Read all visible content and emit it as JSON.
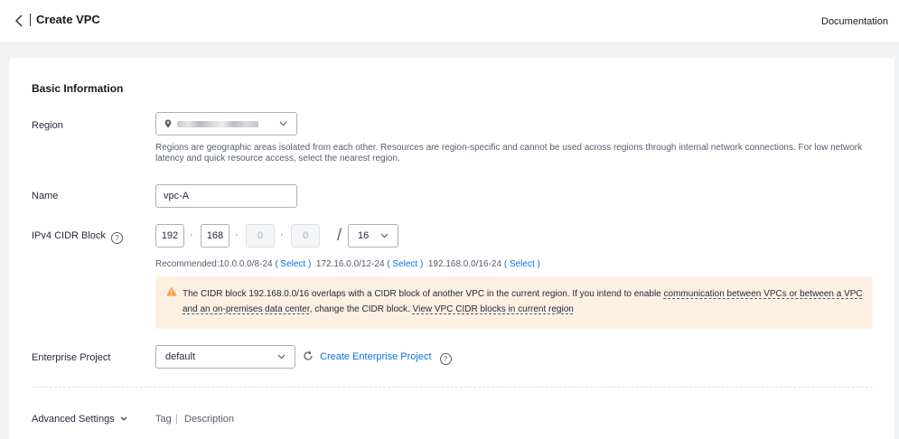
{
  "header": {
    "title": "Create VPC",
    "documentation": "Documentation"
  },
  "basic": {
    "section_title": "Basic Information",
    "region": {
      "label": "Region",
      "hint": "Regions are geographic areas isolated from each other. Resources are region-specific and cannot be used across regions through internal network connections. For low network latency and quick resource access, select the nearest region."
    },
    "name": {
      "label": "Name",
      "value": "vpc-A"
    },
    "cidr": {
      "label": "IPv4 CIDR Block",
      "help": "?",
      "octets": [
        "192",
        "168",
        "0",
        "0"
      ],
      "mask": "16",
      "recommended_prefix": "Recommended:",
      "rec1": "10.0.0.0/8-24",
      "rec2": "172.16.0.0/12-24",
      "rec3": "192.168.0.0/16-24",
      "select_label": "Select",
      "warning": {
        "part1": "The CIDR block 192.168.0.0/16 overlaps with a CIDR block of another VPC in the current region. If you intend to enable ",
        "link1": "communication between VPCs or between a VPC and an on-premises data center",
        "part2": ", change the CIDR block. ",
        "link2": "View VPC CIDR blocks in current region"
      }
    },
    "enterprise": {
      "label": "Enterprise Project",
      "value": "default",
      "create_link": "Create Enterprise Project",
      "help": "?"
    }
  },
  "advanced": {
    "label": "Advanced Settings",
    "tag": "Tag",
    "separator": "|",
    "description": "Description"
  },
  "colors": {
    "link": "#0d6fe0",
    "warning_bg": "#fdf0e3",
    "warning_icon": "#fa9841"
  }
}
